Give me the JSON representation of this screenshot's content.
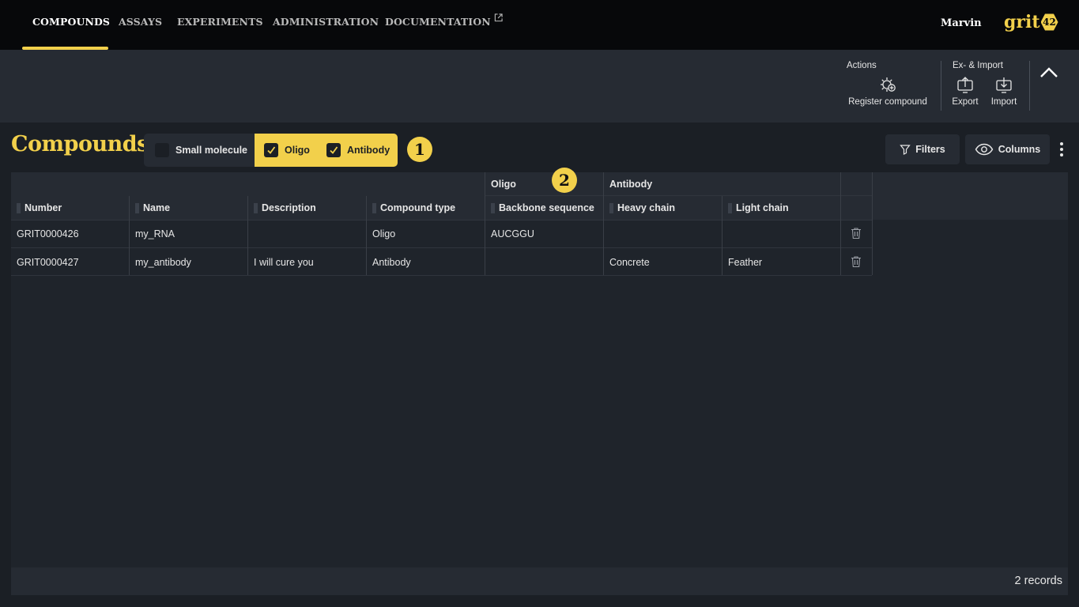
{
  "nav": {
    "items": [
      "COMPOUNDS",
      "ASSAYS",
      "EXPERIMENTS",
      "ADMINISTRATION",
      "DOCUMENTATION"
    ],
    "active": "COMPOUNDS",
    "user": "Marvin",
    "logo_text": "grit",
    "logo_badge": "42"
  },
  "toolbar": {
    "actions_label": "Actions",
    "register_label": "Register compound",
    "eximport_label": "Ex- & Import",
    "export_label": "Export",
    "import_label": "Import"
  },
  "page": {
    "title": "Compounds",
    "type_filter": [
      {
        "label": "Small molecule",
        "checked": false
      },
      {
        "label": "Oligo",
        "checked": true
      },
      {
        "label": "Antibody",
        "checked": true
      }
    ],
    "marker_1": "1",
    "marker_2": "2",
    "filters_label": "Filters",
    "columns_label": "Columns"
  },
  "table": {
    "groups": {
      "oligo": "Oligo",
      "antibody": "Antibody"
    },
    "columns": [
      "Number",
      "Name",
      "Description",
      "Compound type",
      "Backbone sequence",
      "Heavy chain",
      "Light chain"
    ],
    "rows": [
      [
        "GRIT0000426",
        "my_RNA",
        "",
        "Oligo",
        "AUCGGU",
        "",
        ""
      ],
      [
        "GRIT0000427",
        "my_antibody",
        "I will cure you",
        "Antibody",
        "",
        "Concrete",
        "Feather"
      ]
    ],
    "records": "2 records"
  },
  "colors": {
    "accent": "#f2d04b",
    "background": "#1b1f25",
    "nav_bg": "#07080a"
  }
}
